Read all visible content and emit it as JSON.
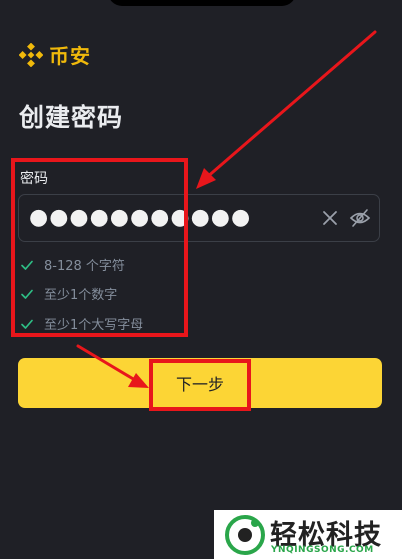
{
  "header": {
    "brand": "币安"
  },
  "page": {
    "title": "创建密码"
  },
  "password_field": {
    "label": "密码",
    "masked_value": "●●●●●●●●●●●",
    "clear_icon": "close-icon",
    "visibility_icon": "eye-off-icon"
  },
  "requirements": [
    {
      "text": "8-128 个字符",
      "met": true
    },
    {
      "text": "至少1个数字",
      "met": true
    },
    {
      "text": "至少1个大写字母",
      "met": true
    }
  ],
  "next_button": {
    "label": "下一步"
  },
  "colors": {
    "brand_yellow": "#f0b90b",
    "button_yellow": "#fcd535",
    "check_green": "#2ebd85",
    "annotation_red": "#e8161b",
    "background": "#1f2026"
  },
  "watermark": {
    "cn": "轻松科技",
    "en": "YNQINGSONG.COM"
  }
}
